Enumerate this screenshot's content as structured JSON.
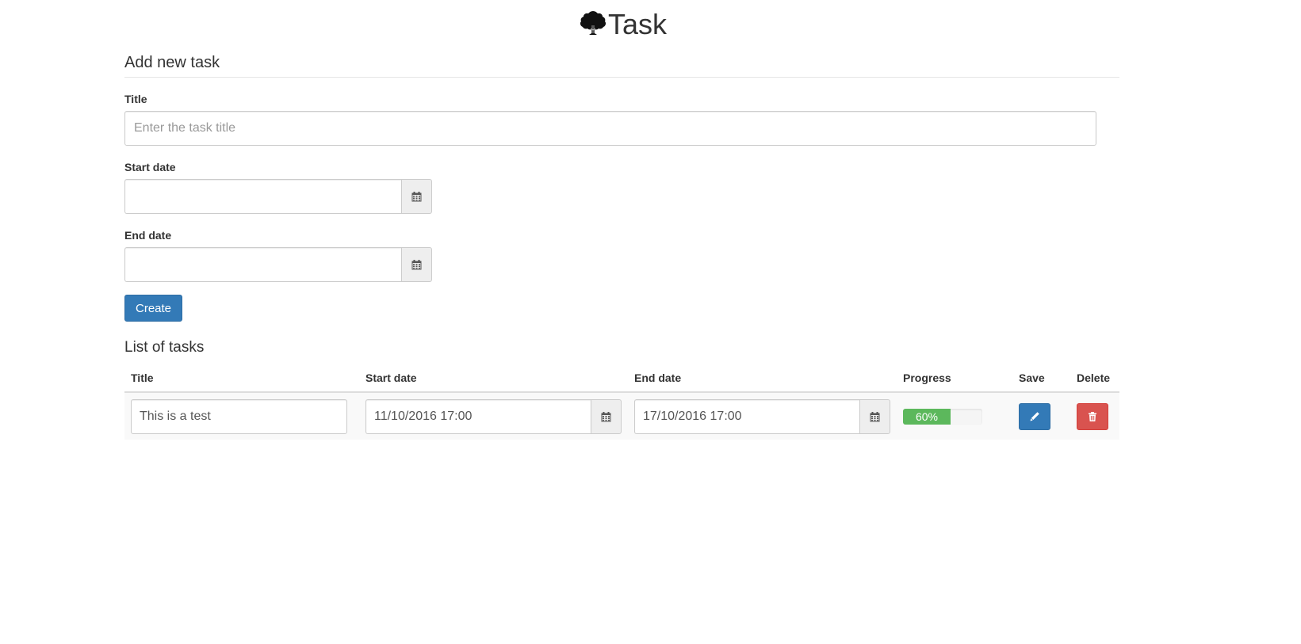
{
  "header": {
    "title": "Task",
    "logo_icon": "tree-icon"
  },
  "add_form": {
    "heading": "Add new task",
    "title_label": "Title",
    "title_placeholder": "Enter the task title",
    "title_value": "",
    "start_label": "Start date",
    "start_value": "",
    "end_label": "End date",
    "end_value": "",
    "calendar_icon": "calendar-icon",
    "create_label": "Create"
  },
  "task_list": {
    "heading": "List of tasks",
    "columns": [
      "Title",
      "Start date",
      "End date",
      "Progress",
      "Save",
      "Delete"
    ],
    "rows": [
      {
        "title": "This is a test",
        "start": "11/10/2016 17:00",
        "end": "17/10/2016 17:00",
        "progress_percent": 60,
        "progress_label": "60%",
        "save_icon": "pencil-icon",
        "delete_icon": "trash-icon"
      }
    ]
  },
  "colors": {
    "primary": "#337ab7",
    "danger": "#d9534f",
    "success": "#5cb85c"
  }
}
